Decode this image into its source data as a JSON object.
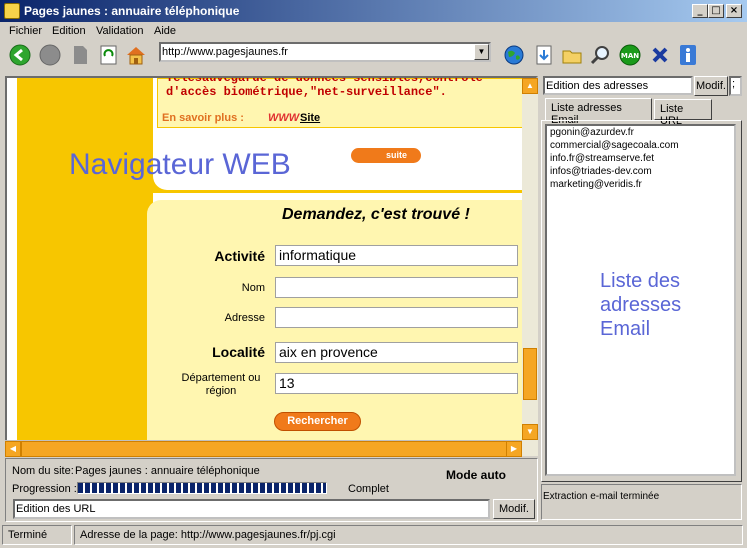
{
  "window": {
    "title": "Pages jaunes : annuaire téléphonique",
    "min_label": "_",
    "max_label": "□",
    "close_label": "×"
  },
  "menu": {
    "items": [
      "Fichier",
      "Edition",
      "Validation",
      "Aide"
    ]
  },
  "toolbar": {
    "url": "http://www.pagesjaunes.fr",
    "icons": [
      "back-icon",
      "stop-icon",
      "page-icon",
      "refresh-icon",
      "home-icon",
      "globe-icon",
      "download-icon",
      "folder-icon",
      "search-icon",
      "man-icon",
      "close-icon",
      "info-icon"
    ],
    "man_label": "MAN"
  },
  "browser": {
    "overlay_label": "Navigateur WEB",
    "ad_text": "Télésauvegarde de données sensibles,contrôle d'accès biométrique,\"net-surveillance\".",
    "more_label": "En savoir plus :",
    "www_label": "WWW",
    "site_label": "Site",
    "suite_label": "suite",
    "form_title": "Demandez, c'est trouvé !",
    "fields": [
      {
        "label": "Activité",
        "value": "informatique"
      },
      {
        "label": "Nom",
        "value": ""
      },
      {
        "label": "Adresse",
        "value": ""
      },
      {
        "label": "Localité",
        "value": "aix en provence"
      },
      {
        "label": "Département ou région",
        "value": "13"
      }
    ],
    "search_label": "Rechercher"
  },
  "right_panel": {
    "edition_value": "Edition des adresses",
    "modif_label": "Modif.",
    "small_value": ";",
    "tabs": [
      "Liste adresses Email",
      "Liste URL"
    ],
    "emails": [
      "pgonin@azurdev.fr",
      "commercial@sagecoala.com",
      "info.fr@streamserve.fet",
      "infos@triades-dev.com",
      "marketing@veridis.fr"
    ],
    "overlay_label_lines": [
      "Liste des",
      "adresses",
      "Email"
    ],
    "status": "Extraction e-mail terminée"
  },
  "bottom": {
    "site_label": "Nom du site:",
    "site_value": "Pages jaunes : annuaire téléphonique",
    "mode_label": "Mode auto",
    "progress_label": "Progression :",
    "progress_status": "Complet",
    "progress_value": 1.0,
    "url_edit_value": "Edition des URL",
    "modif_label": "Modif."
  },
  "statusbar": {
    "left": "Terminé",
    "right": "Adresse de la page: http://www.pagesjaunes.fr/pj.cgi"
  },
  "colors": {
    "title": "#0a246a",
    "yellow_dark": "#f7c600",
    "yellow_light": "#fff6b0",
    "orange": "#f07a1a",
    "red_text": "#c00000",
    "overlay_blue": "#5a66d6"
  }
}
